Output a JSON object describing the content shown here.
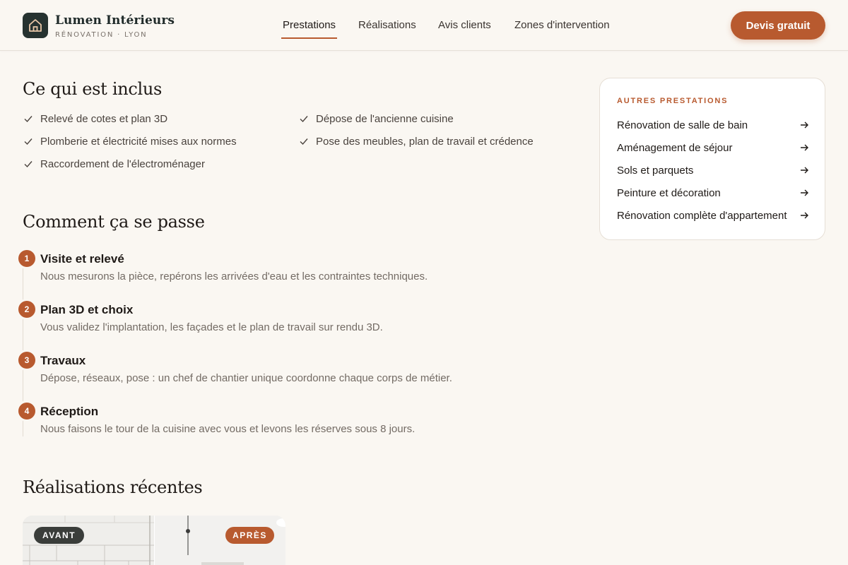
{
  "brand": {
    "name": "Lumen Intérieurs",
    "tagline": "RÉNOVATION · LYON",
    "icon": "house-icon"
  },
  "nav": {
    "items": [
      {
        "label": "Prestations",
        "active": true
      },
      {
        "label": "Réalisations",
        "active": false
      },
      {
        "label": "Avis clients",
        "active": false
      },
      {
        "label": "Zones d'intervention",
        "active": false
      }
    ],
    "cta_label": "Devis gratuit"
  },
  "included": {
    "title": "Ce qui est inclus",
    "icon": "check-icon",
    "items": [
      "Relevé de cotes et plan 3D",
      "Dépose de l'ancienne cuisine",
      "Plomberie et électricité mises aux normes",
      "Pose des meubles, plan de travail et crédence",
      "Raccordement de l'électroménager"
    ]
  },
  "process": {
    "title": "Comment ça se passe",
    "steps": [
      {
        "number": "1",
        "title": "Visite et relevé",
        "description": "Nous mesurons la pièce, repérons les arrivées d'eau et les contraintes techniques."
      },
      {
        "number": "2",
        "title": "Plan 3D et choix",
        "description": "Vous validez l'implantation, les façades et le plan de travail sur rendu 3D."
      },
      {
        "number": "3",
        "title": "Travaux",
        "description": "Dépose, réseaux, pose : un chef de chantier unique coordonne chaque corps de métier."
      },
      {
        "number": "4",
        "title": "Réception",
        "description": "Nous faisons le tour de la cuisine avec vous et levons les réserves sous 8 jours."
      }
    ]
  },
  "other_services": {
    "title": "AUTRES PRESTATIONS",
    "icon": "arrow-right-icon",
    "links": [
      "Rénovation de salle de bain",
      "Aménagement de séjour",
      "Sols et parquets",
      "Peinture et décoration",
      "Rénovation complète d'appartement"
    ]
  },
  "recent_works": {
    "title": "Réalisations récentes",
    "before_label": "AVANT",
    "after_label": "APRÈS"
  },
  "colors": {
    "accent": "#b85a2f",
    "background": "#faf7f2",
    "logo_bg": "#263230"
  }
}
